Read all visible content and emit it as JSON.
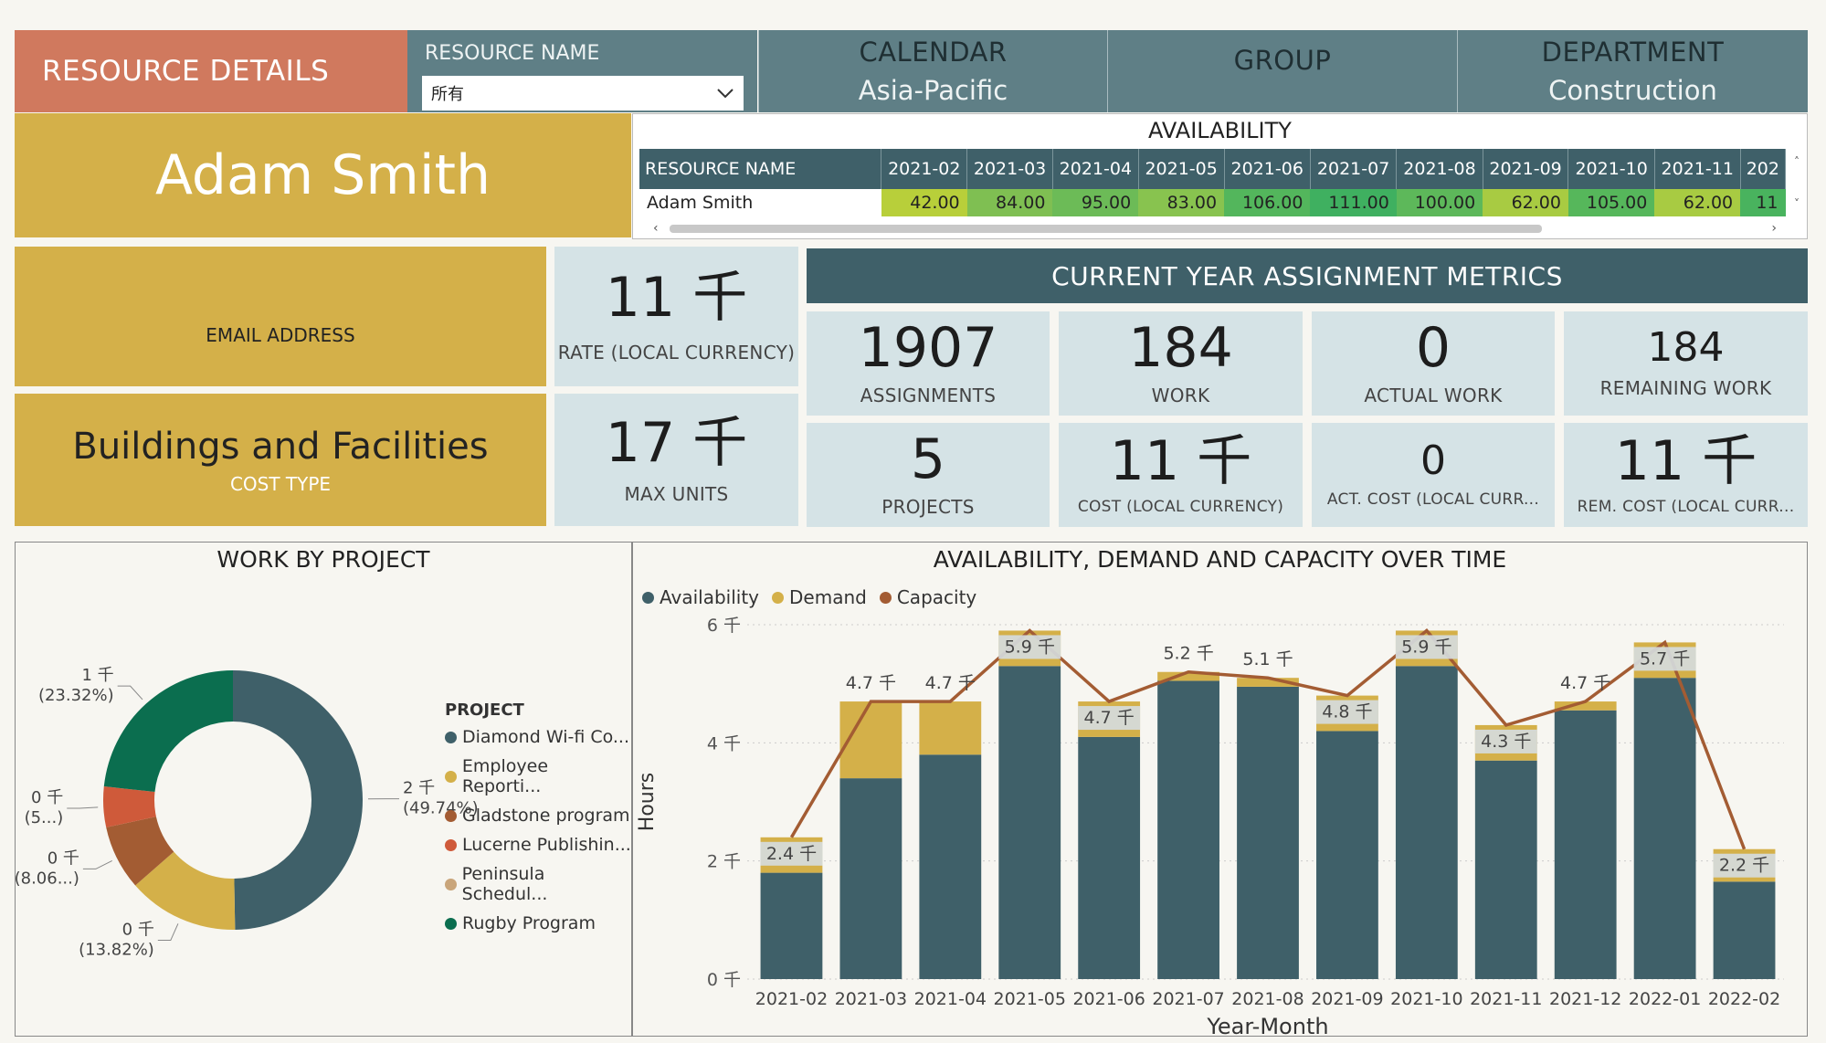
{
  "header": {
    "title": "RESOURCE DETAILS",
    "resource_name_label": "RESOURCE NAME",
    "resource_name_value": "所有",
    "calendar_label": "CALENDAR",
    "calendar_value": "Asia-Pacific",
    "group_label": "GROUP",
    "group_value": "",
    "department_label": "DEPARTMENT",
    "department_value": "Construction"
  },
  "resource": {
    "name": "Adam Smith",
    "email_label": "EMAIL ADDRESS",
    "cost_type_value": "Buildings and Facilities",
    "cost_type_label": "COST TYPE",
    "rate_value": "11 千",
    "rate_label": "RATE (LOCAL CURRENCY)",
    "max_units_value": "17 千",
    "max_units_label": "MAX UNITS"
  },
  "availability": {
    "title": "AVAILABILITY",
    "columns": [
      "RESOURCE NAME",
      "2021-02",
      "2021-03",
      "2021-04",
      "2021-05",
      "2021-06",
      "2021-07",
      "2021-08",
      "2021-09",
      "2021-10",
      "2021-11",
      "202"
    ],
    "rows": [
      {
        "name": "Adam Smith",
        "values": [
          "42.00",
          "84.00",
          "95.00",
          "83.00",
          "106.00",
          "111.00",
          "100.00",
          "62.00",
          "105.00",
          "62.00",
          "11"
        ],
        "colors": [
          "#b8cf3a",
          "#7fbf52",
          "#6cbb57",
          "#88c34f",
          "#53b65c",
          "#3fb060",
          "#5db85a",
          "#a8cb42",
          "#56b75b",
          "#a8cb42",
          "#49b35e"
        ]
      }
    ]
  },
  "metrics": {
    "title": "CURRENT YEAR ASSIGNMENT METRICS",
    "items": [
      {
        "value": "1907",
        "label": "ASSIGNMENTS"
      },
      {
        "value": "184",
        "label": "WORK"
      },
      {
        "value": "0",
        "label": "ACTUAL WORK"
      },
      {
        "value": "184",
        "label": "REMAINING WORK"
      },
      {
        "value": "5",
        "label": "PROJECTS"
      },
      {
        "value": "11 千",
        "label": "COST (LOCAL CURRENCY)"
      },
      {
        "value": "0",
        "label": "ACT. COST (LOCAL CURR..."
      },
      {
        "value": "11 千",
        "label": "REM. COST (LOCAL CURR..."
      }
    ]
  },
  "donut": {
    "title": "WORK BY PROJECT",
    "legend_title": "PROJECT",
    "slices": [
      {
        "name": "Diamond Wi-fi Co...",
        "share": 49.74,
        "color": "#3f6069",
        "label_value": "2 千",
        "label_pct": "(49.74%)"
      },
      {
        "name": "Employee Reporti...",
        "share": 13.82,
        "color": "#d4b049",
        "label_value": "0 千",
        "label_pct": "(13.82%)"
      },
      {
        "name": "Gladstone program",
        "share": 8.06,
        "color": "#a35c33",
        "label_value": "0 千",
        "label_pct": "(8.06...)"
      },
      {
        "name": "Lucerne Publishin...",
        "share": 5.06,
        "color": "#cf5a3a",
        "label_value": "0 千",
        "label_pct": "(5...)"
      },
      {
        "name": "Peninsula Schedul...",
        "share": 0,
        "color": "#c9a57a",
        "label_value": "",
        "label_pct": ""
      },
      {
        "name": "Rugby Program",
        "share": 23.32,
        "color": "#0b6e4f",
        "label_value": "1 千",
        "label_pct": "(23.32%)"
      }
    ]
  },
  "chart_data": {
    "type": "bar",
    "title": "AVAILABILITY, DEMAND AND CAPACITY OVER TIME",
    "xlabel": "Year-Month",
    "ylabel": "Hours",
    "ylim": [
      0,
      6000
    ],
    "yticks": [
      "0 千",
      "2 千",
      "4 千",
      "6 千"
    ],
    "legend_placement": "top-left",
    "categories": [
      "2021-02",
      "2021-03",
      "2021-04",
      "2021-05",
      "2021-06",
      "2021-07",
      "2021-08",
      "2021-09",
      "2021-10",
      "2021-11",
      "2021-12",
      "2022-01",
      "2022-02"
    ],
    "series": [
      {
        "name": "Availability",
        "color": "#3f6069",
        "values": [
          1800,
          3400,
          3800,
          5300,
          4100,
          5050,
          4950,
          4200,
          5300,
          3700,
          4550,
          5100,
          1650
        ]
      },
      {
        "name": "Demand",
        "color": "#d4b049",
        "values": [
          600,
          1300,
          900,
          600,
          600,
          150,
          150,
          600,
          600,
          600,
          150,
          600,
          550
        ]
      },
      {
        "name": "Capacity",
        "color": "#a35c33",
        "type": "line",
        "values": [
          2400,
          4700,
          4700,
          5900,
          4700,
          5200,
          5100,
          4800,
          5900,
          4300,
          4700,
          5700,
          2200
        ]
      }
    ],
    "data_labels": [
      "2.4 千",
      "4.7 千",
      "4.7 千",
      "5.9 千",
      "4.7 千",
      "5.2 千",
      "5.1 千",
      "4.8 千",
      "5.9 千",
      "4.3 千",
      "4.7 千",
      "5.7 千",
      "2.2 千"
    ]
  }
}
